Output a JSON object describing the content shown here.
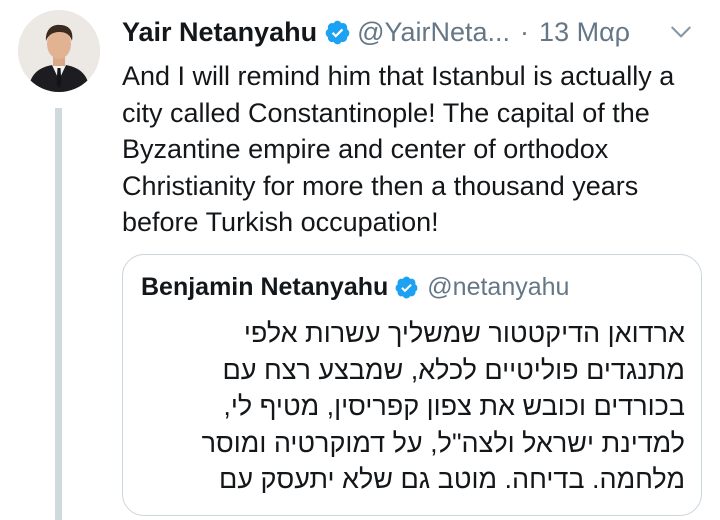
{
  "tweet": {
    "author": {
      "display_name": "Yair Netanyahu",
      "handle": "@YairNeta...",
      "verified": true
    },
    "separator": "·",
    "timestamp": "13 Μαρ",
    "body": "And I will remind him that Istanbul is actually a city called Constantinople! The capital of the Byzantine empire and center of orthodox Christianity for more then a thousand years before Turkish occupation!",
    "more_icon": "chevron-down-icon"
  },
  "quoted_tweet": {
    "author": {
      "display_name": "Benjamin Netanyahu",
      "handle": "@netanyahu",
      "verified": true
    },
    "body": "ארדואן הדיקטטור שמשליך עשרות אלפי מתנגדים פוליטיים לכלא, שמבצע רצח עם בכורדים וכובש את צפון קפריסין, מטיף לי, למדינת ישראל ולצה\"ל, על דמוקרטיה ומוסר מלחמה. בדיחה. מוטב גם שלא יתעסק עם"
  },
  "colors": {
    "verified_blue": "#1da1f2",
    "secondary_text": "#657786",
    "thread_line": "#cfd9de",
    "quote_border": "#ccd6dd"
  }
}
